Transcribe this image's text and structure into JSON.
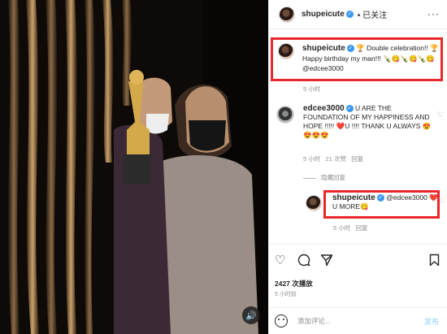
{
  "post": {
    "author": "shupeicute",
    "follow_label": "• 已关注",
    "more_label": "···"
  },
  "caption": {
    "username": "shupeicute",
    "text": "🏆 Double celebration!! 🏆Happy birthday my man!!! 🍾😋🍾😋🍾😋 @edcee3000",
    "time": "5 小时"
  },
  "comments": [
    {
      "username": "edcee3000",
      "text": "U ARE THE FOUNDATION OF MY HAPPINESS AND HOPE !!!!! ❤️U !!!! THANK U ALWAYS 😍😍😍😍",
      "time": "5 小时",
      "likes": "21 次赞",
      "reply_label": "回复"
    }
  ],
  "hide_replies_label": "隐藏回复",
  "reply": {
    "username": "shupeicute",
    "text": "@edcee3000 ❤️U MORE😋",
    "time": "5 小时",
    "reply_label": "回复"
  },
  "stats": {
    "plays": "2427 次播放",
    "date": "5 小时前"
  },
  "add_comment": {
    "placeholder": "添加评论...",
    "post_label": "发布"
  },
  "colors": {
    "highlight_box": "#e8272b",
    "verified": "#3897f0",
    "meta_text": "#8e8e8e"
  }
}
